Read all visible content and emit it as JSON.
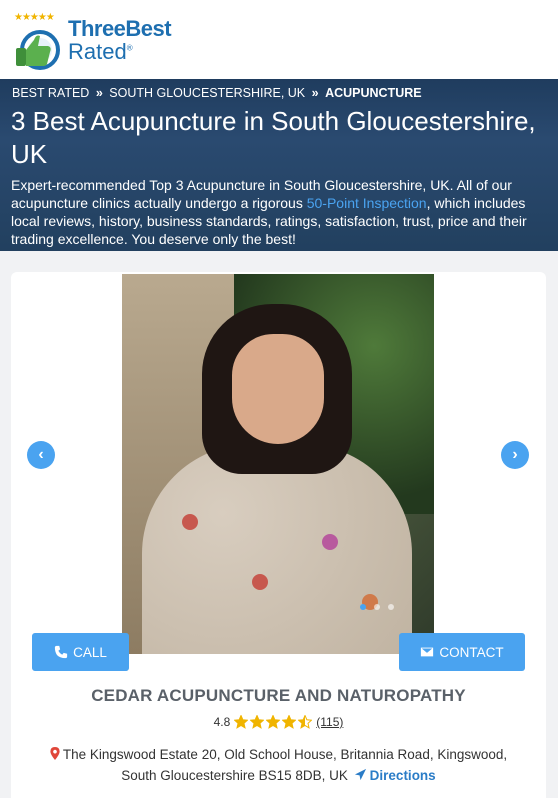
{
  "logo": {
    "line1": "ThreeBest",
    "line2": "Rated",
    "reg": "®",
    "stars": "★★★★★"
  },
  "breadcrumb": {
    "home": "BEST RATED",
    "sep": "»",
    "region": "SOUTH GLOUCESTERSHIRE, UK",
    "current": "ACUPUNCTURE"
  },
  "hero": {
    "title": "3 Best Acupuncture in South Gloucestershire, UK",
    "intro_before": "Expert-recommended Top 3 Acupuncture in South Gloucestershire, UK. All of our acupuncture clinics actually undergo a rigorous ",
    "intro_link": "50-Point Inspection",
    "intro_after": ", which includes local reviews, history, business standards, ratings, satisfaction, trust, price and their trading excellence. You deserve only the best!"
  },
  "listing": {
    "carousel": {
      "prev_icon": "chevron-left-icon",
      "next_icon": "chevron-right-icon",
      "prev": "‹",
      "next": "›",
      "slide_count": 3,
      "active_slide": 1
    },
    "call_label": "CALL",
    "contact_label": "CONTACT",
    "name": "CEDAR ACUPUNCTURE AND NATUROPATHY",
    "rating_value": "4.8",
    "stars": 4.5,
    "reviews": "(115)",
    "address_line1": "The Kingswood Estate 20, Old School House, Britannia Road, Kingswood,",
    "address_line2": "South Gloucestershire BS15 8DB, UK",
    "directions_label": "Directions"
  },
  "colors": {
    "accent": "#4aa3f0",
    "hero_bg": "#22405f",
    "star": "#f0b400"
  }
}
